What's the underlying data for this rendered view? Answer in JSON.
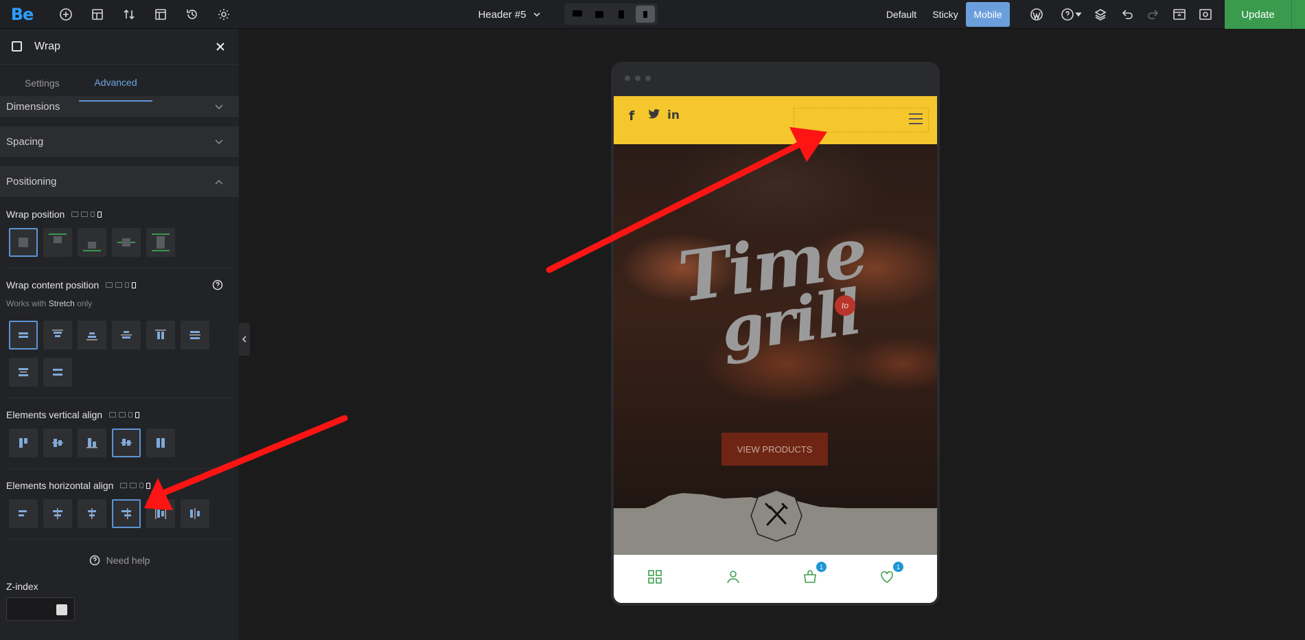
{
  "topbar": {
    "logo": "Be",
    "header_select": "Header #5",
    "states": [
      "Default",
      "Sticky",
      "Mobile"
    ],
    "update_label": "Update"
  },
  "sidebar": {
    "title": "Wrap",
    "tabs": [
      "Settings",
      "Advanced"
    ],
    "accordions": {
      "dimensions": "Dimensions",
      "spacing": "Spacing",
      "positioning": "Positioning"
    },
    "wrap_position": {
      "label": "Wrap position",
      "selected_index": 0
    },
    "wrap_content_position": {
      "label": "Wrap content position",
      "note_prefix": "Works with",
      "note_bold": "Stretch",
      "note_suffix": "only",
      "selected_index": 0
    },
    "elements_vertical_align": {
      "label": "Elements vertical align",
      "selected_index": 3
    },
    "elements_horizontal_align": {
      "label": "Elements horizontal align",
      "selected_index": 3
    },
    "need_help": "Need help",
    "zindex_label": "Z-index",
    "zindex_value": ""
  },
  "preview": {
    "social": [
      "f",
      "t",
      "in"
    ],
    "hero_logo_line1": "Time",
    "hero_logo_line2": "grill",
    "hero_badge": "to",
    "cta": "VIEW PRODUCTS",
    "cart_count": "1",
    "wishlist_count": "1"
  },
  "colors": {
    "accent_blue": "#6b9fdc",
    "update_green": "#3a9a4d",
    "header_yellow": "#f5c72d",
    "annotation_red": "#ff1414"
  }
}
